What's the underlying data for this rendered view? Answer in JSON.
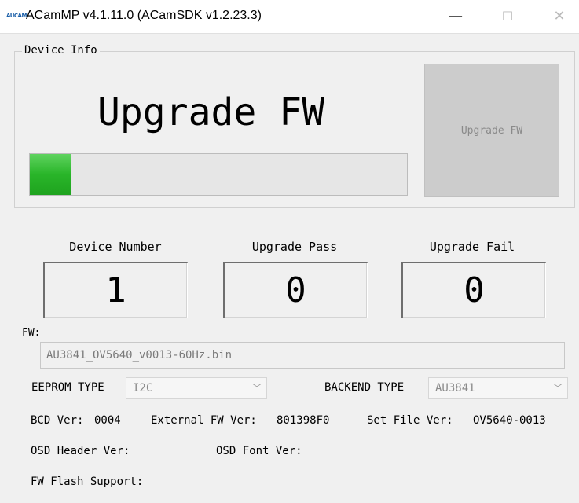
{
  "window": {
    "title": "ACamMP v4.1.11.0 (ACamSDK v1.2.23.3)",
    "icon_text": "AUCAM",
    "minimize": "—",
    "maximize": "☐",
    "close": "✕"
  },
  "device_info": {
    "group_label": "Device Info",
    "headline": "Upgrade FW",
    "progress_fraction": 0.11,
    "upgrade_button_label": "Upgrade FW"
  },
  "stats": {
    "device_number_label": "Device Number",
    "device_number_value": "1",
    "upgrade_pass_label": "Upgrade Pass",
    "upgrade_pass_value": "0",
    "upgrade_fail_label": "Upgrade Fail",
    "upgrade_fail_value": "0"
  },
  "fw": {
    "label": "FW:",
    "file_value": "AU3841_OV5640_v0013-60Hz.bin"
  },
  "eeprom": {
    "label": "EEPROM TYPE",
    "value": "I2C"
  },
  "backend": {
    "label": "BACKEND TYPE",
    "value": "AU3841"
  },
  "versions": {
    "bcd_label": "BCD Ver:",
    "bcd_value": "0004",
    "external_fw_label": "External FW Ver:",
    "external_fw_value": "801398F0",
    "set_file_label": "Set File Ver:",
    "set_file_value": "OV5640-0013",
    "osd_header_label": "OSD Header Ver:",
    "osd_font_label": "OSD Font Ver:",
    "fw_flash_label": "FW Flash Support:"
  },
  "icons": {
    "chevron": "﹀"
  },
  "colors": {
    "progress_green": "#29b529",
    "disabled_button": "#cccccc"
  }
}
